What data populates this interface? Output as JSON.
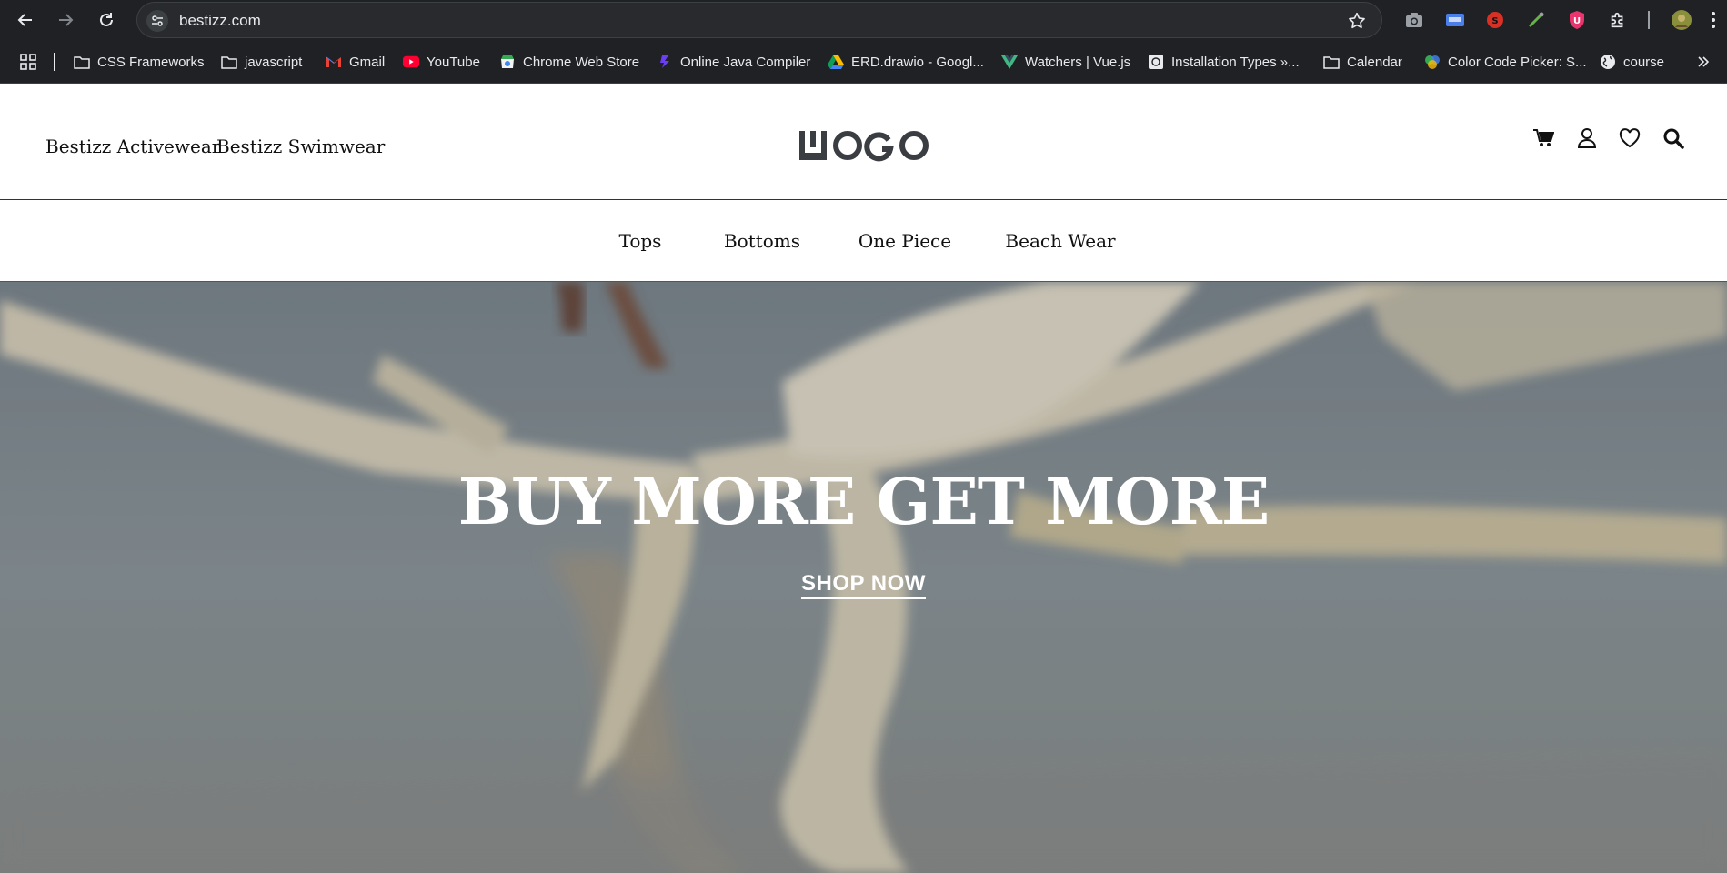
{
  "browser": {
    "url": "bestizz.com",
    "bookmarks": [
      {
        "label": "CSS Frameworks",
        "icon": "folder-icon"
      },
      {
        "label": "javascript",
        "icon": "folder-icon"
      },
      {
        "label": "Gmail",
        "icon": "gmail-icon"
      },
      {
        "label": "YouTube",
        "icon": "youtube-icon"
      },
      {
        "label": "Chrome Web Store",
        "icon": "chrome-web-store-icon"
      },
      {
        "label": "Online Java Compiler",
        "icon": "java-compiler-icon"
      },
      {
        "label": "ERD.drawio - Googl...",
        "icon": "google-drive-icon"
      },
      {
        "label": "Watchers | Vue.js",
        "icon": "vue-icon"
      },
      {
        "label": "Installation Types »...",
        "icon": "docs-icon"
      },
      {
        "label": "Calendar",
        "icon": "folder-icon"
      },
      {
        "label": "Color Code Picker: S...",
        "icon": "color-picker-icon"
      },
      {
        "label": "course",
        "icon": "globe-icon"
      }
    ]
  },
  "header": {
    "brand_links": [
      "Bestizz Activewear",
      "Bestizz Swimwear"
    ],
    "logo_text": "LOGO",
    "icons": [
      "cart-icon",
      "user-icon",
      "heart-icon",
      "search-icon"
    ]
  },
  "categories": [
    "Tops",
    "Bottoms",
    "One Piece",
    "Beach Wear"
  ],
  "hero": {
    "title": "BUY MORE GET MORE",
    "cta": "SHOP NOW"
  },
  "colors": {
    "chrome_bg": "#202124",
    "hero_text": "#ffffff",
    "logo": "#3a3d42"
  }
}
